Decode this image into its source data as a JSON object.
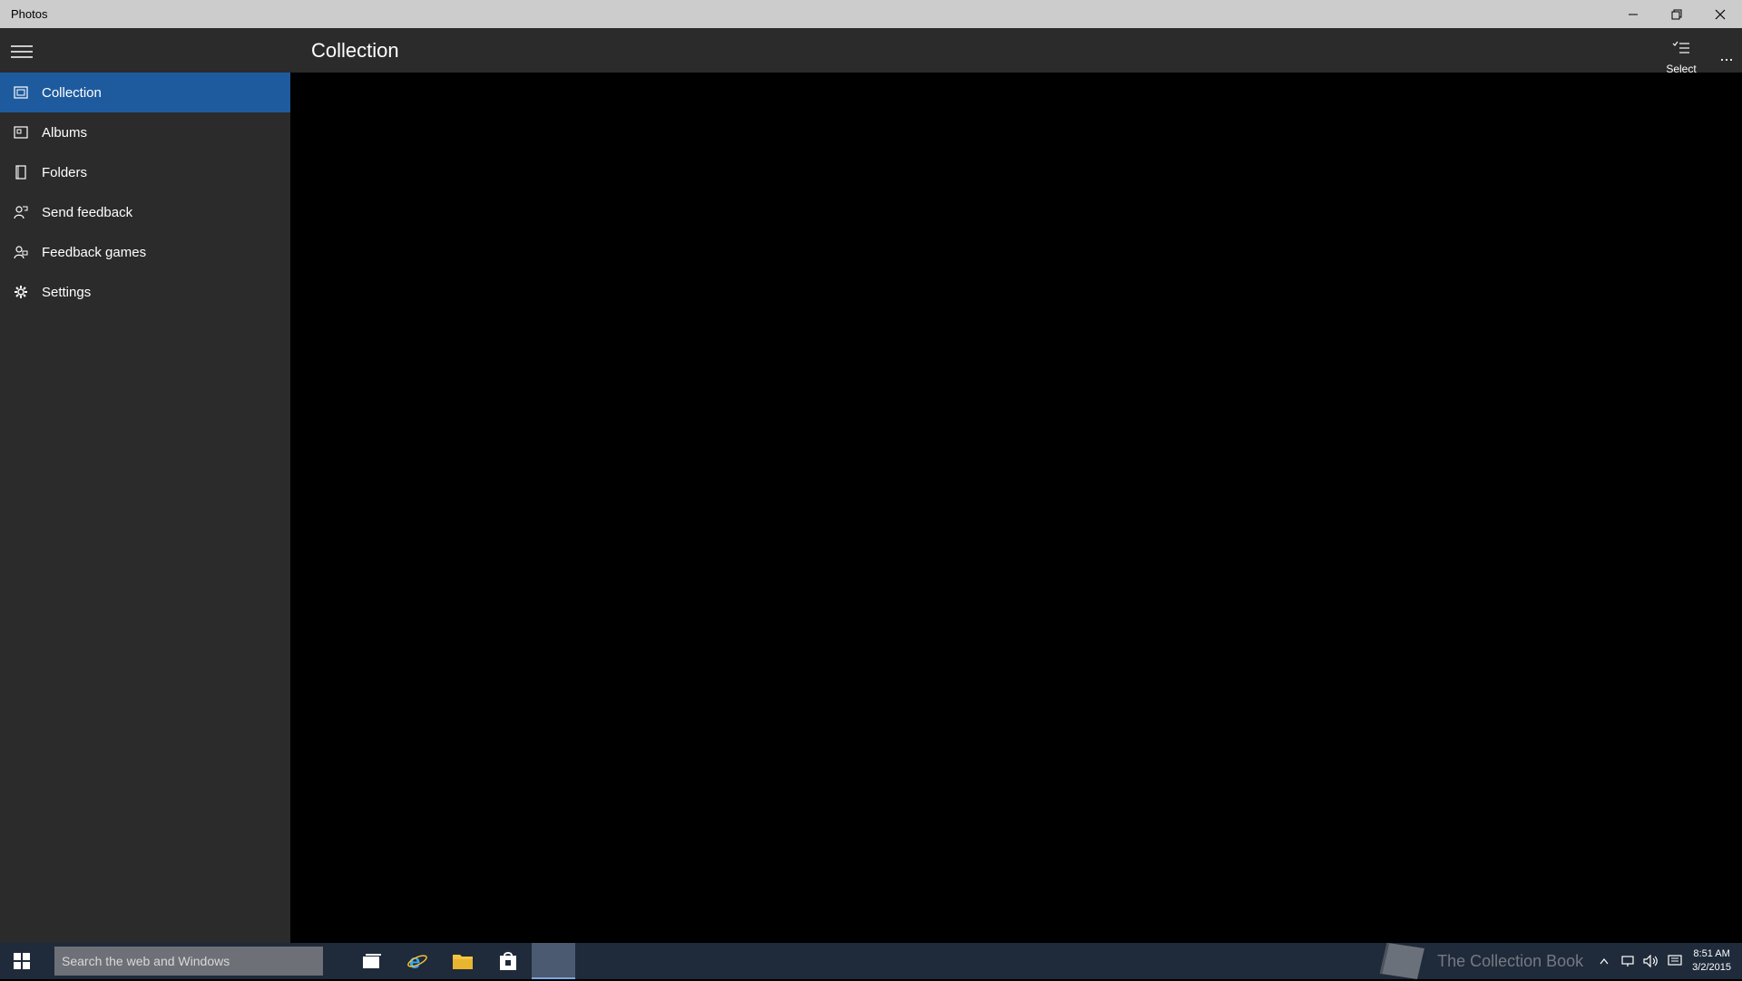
{
  "window": {
    "title": "Photos"
  },
  "header": {
    "title": "Collection"
  },
  "toolbar": {
    "select_label": "Select",
    "more_label": "..."
  },
  "sidebar": {
    "items": [
      {
        "label": "Collection",
        "icon": "collection-icon",
        "active": true
      },
      {
        "label": "Albums",
        "icon": "albums-icon",
        "active": false
      },
      {
        "label": "Folders",
        "icon": "folders-icon",
        "active": false
      },
      {
        "label": "Send feedback",
        "icon": "send-feedback-icon",
        "active": false
      },
      {
        "label": "Feedback games",
        "icon": "feedback-games-icon",
        "active": false
      },
      {
        "label": "Settings",
        "icon": "gear-icon",
        "active": false
      }
    ]
  },
  "taskbar": {
    "search_placeholder": "Search the web and Windows",
    "watermark_text": "The Collection Book",
    "clock_time": "8:51 AM",
    "clock_date": "3/2/2015"
  },
  "colors": {
    "accent": "#1e5b9e",
    "sidebar_bg": "#2b2b2b",
    "content_bg": "#000000",
    "titlebar_bg": "#cccccc",
    "taskbar_bg": "#1f2a3a"
  }
}
